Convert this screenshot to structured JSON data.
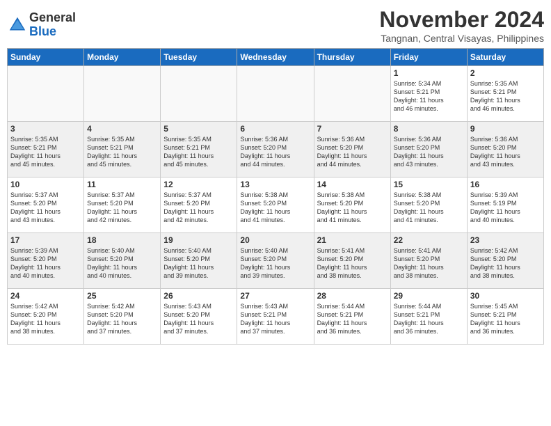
{
  "logo": {
    "general": "General",
    "blue": "Blue"
  },
  "title": {
    "month_year": "November 2024",
    "location": "Tangnan, Central Visayas, Philippines"
  },
  "weekdays": [
    "Sunday",
    "Monday",
    "Tuesday",
    "Wednesday",
    "Thursday",
    "Friday",
    "Saturday"
  ],
  "weeks": [
    [
      {
        "day": "",
        "info": ""
      },
      {
        "day": "",
        "info": ""
      },
      {
        "day": "",
        "info": ""
      },
      {
        "day": "",
        "info": ""
      },
      {
        "day": "",
        "info": ""
      },
      {
        "day": "1",
        "info": "Sunrise: 5:34 AM\nSunset: 5:21 PM\nDaylight: 11 hours\nand 46 minutes."
      },
      {
        "day": "2",
        "info": "Sunrise: 5:35 AM\nSunset: 5:21 PM\nDaylight: 11 hours\nand 46 minutes."
      }
    ],
    [
      {
        "day": "3",
        "info": "Sunrise: 5:35 AM\nSunset: 5:21 PM\nDaylight: 11 hours\nand 45 minutes."
      },
      {
        "day": "4",
        "info": "Sunrise: 5:35 AM\nSunset: 5:21 PM\nDaylight: 11 hours\nand 45 minutes."
      },
      {
        "day": "5",
        "info": "Sunrise: 5:35 AM\nSunset: 5:21 PM\nDaylight: 11 hours\nand 45 minutes."
      },
      {
        "day": "6",
        "info": "Sunrise: 5:36 AM\nSunset: 5:20 PM\nDaylight: 11 hours\nand 44 minutes."
      },
      {
        "day": "7",
        "info": "Sunrise: 5:36 AM\nSunset: 5:20 PM\nDaylight: 11 hours\nand 44 minutes."
      },
      {
        "day": "8",
        "info": "Sunrise: 5:36 AM\nSunset: 5:20 PM\nDaylight: 11 hours\nand 43 minutes."
      },
      {
        "day": "9",
        "info": "Sunrise: 5:36 AM\nSunset: 5:20 PM\nDaylight: 11 hours\nand 43 minutes."
      }
    ],
    [
      {
        "day": "10",
        "info": "Sunrise: 5:37 AM\nSunset: 5:20 PM\nDaylight: 11 hours\nand 43 minutes."
      },
      {
        "day": "11",
        "info": "Sunrise: 5:37 AM\nSunset: 5:20 PM\nDaylight: 11 hours\nand 42 minutes."
      },
      {
        "day": "12",
        "info": "Sunrise: 5:37 AM\nSunset: 5:20 PM\nDaylight: 11 hours\nand 42 minutes."
      },
      {
        "day": "13",
        "info": "Sunrise: 5:38 AM\nSunset: 5:20 PM\nDaylight: 11 hours\nand 41 minutes."
      },
      {
        "day": "14",
        "info": "Sunrise: 5:38 AM\nSunset: 5:20 PM\nDaylight: 11 hours\nand 41 minutes."
      },
      {
        "day": "15",
        "info": "Sunrise: 5:38 AM\nSunset: 5:20 PM\nDaylight: 11 hours\nand 41 minutes."
      },
      {
        "day": "16",
        "info": "Sunrise: 5:39 AM\nSunset: 5:19 PM\nDaylight: 11 hours\nand 40 minutes."
      }
    ],
    [
      {
        "day": "17",
        "info": "Sunrise: 5:39 AM\nSunset: 5:20 PM\nDaylight: 11 hours\nand 40 minutes."
      },
      {
        "day": "18",
        "info": "Sunrise: 5:40 AM\nSunset: 5:20 PM\nDaylight: 11 hours\nand 40 minutes."
      },
      {
        "day": "19",
        "info": "Sunrise: 5:40 AM\nSunset: 5:20 PM\nDaylight: 11 hours\nand 39 minutes."
      },
      {
        "day": "20",
        "info": "Sunrise: 5:40 AM\nSunset: 5:20 PM\nDaylight: 11 hours\nand 39 minutes."
      },
      {
        "day": "21",
        "info": "Sunrise: 5:41 AM\nSunset: 5:20 PM\nDaylight: 11 hours\nand 38 minutes."
      },
      {
        "day": "22",
        "info": "Sunrise: 5:41 AM\nSunset: 5:20 PM\nDaylight: 11 hours\nand 38 minutes."
      },
      {
        "day": "23",
        "info": "Sunrise: 5:42 AM\nSunset: 5:20 PM\nDaylight: 11 hours\nand 38 minutes."
      }
    ],
    [
      {
        "day": "24",
        "info": "Sunrise: 5:42 AM\nSunset: 5:20 PM\nDaylight: 11 hours\nand 38 minutes."
      },
      {
        "day": "25",
        "info": "Sunrise: 5:42 AM\nSunset: 5:20 PM\nDaylight: 11 hours\nand 37 minutes."
      },
      {
        "day": "26",
        "info": "Sunrise: 5:43 AM\nSunset: 5:20 PM\nDaylight: 11 hours\nand 37 minutes."
      },
      {
        "day": "27",
        "info": "Sunrise: 5:43 AM\nSunset: 5:21 PM\nDaylight: 11 hours\nand 37 minutes."
      },
      {
        "day": "28",
        "info": "Sunrise: 5:44 AM\nSunset: 5:21 PM\nDaylight: 11 hours\nand 36 minutes."
      },
      {
        "day": "29",
        "info": "Sunrise: 5:44 AM\nSunset: 5:21 PM\nDaylight: 11 hours\nand 36 minutes."
      },
      {
        "day": "30",
        "info": "Sunrise: 5:45 AM\nSunset: 5:21 PM\nDaylight: 11 hours\nand 36 minutes."
      }
    ]
  ]
}
